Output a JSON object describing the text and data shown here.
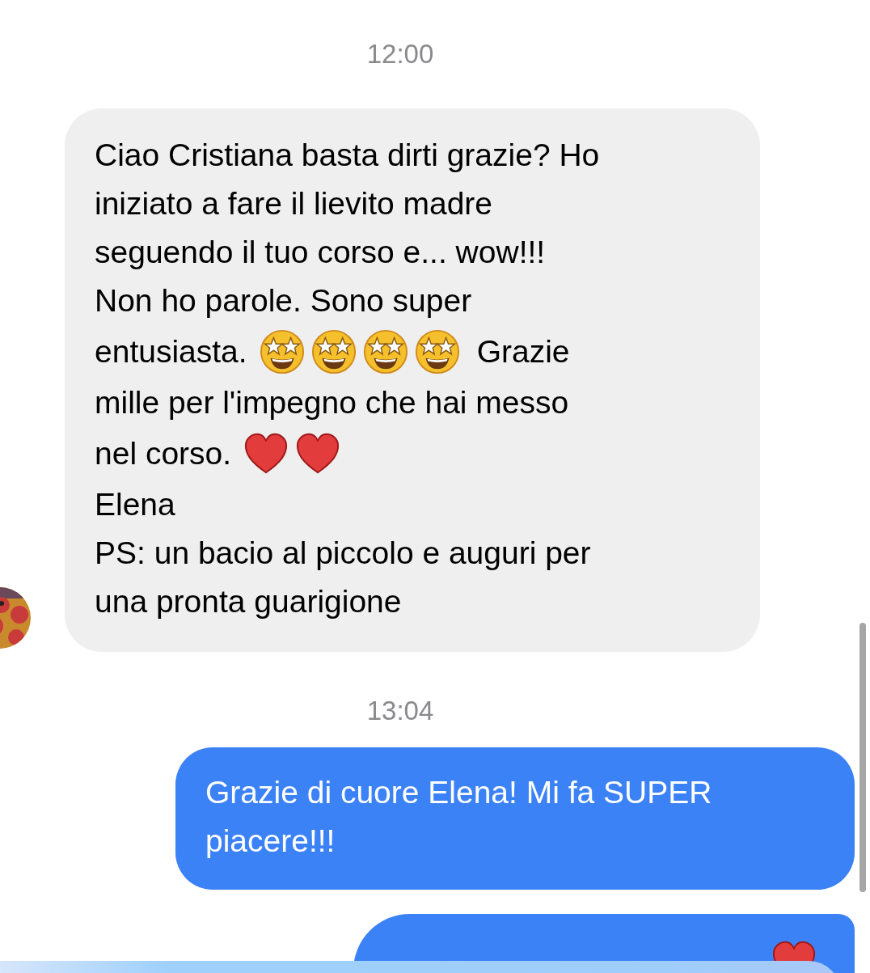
{
  "messages": [
    {
      "kind": "timestamp",
      "text": "12:00"
    },
    {
      "kind": "received",
      "avatar": {
        "kind": "picture"
      },
      "lines": [
        [
          {
            "kind": "text",
            "text": "Ciao Cristiana basta dirti grazie? Ho"
          }
        ],
        [
          {
            "kind": "text",
            "text": "iniziato a fare il lievito madre"
          }
        ],
        [
          {
            "kind": "text",
            "text": "seguendo il tuo corso e... wow!!!"
          }
        ],
        [
          {
            "kind": "text",
            "text": "Non ho parole. Sono super"
          }
        ],
        [
          {
            "kind": "text",
            "text": "entusiasta."
          },
          {
            "kind": "star-struck"
          },
          {
            "kind": "star-struck"
          },
          {
            "kind": "star-struck"
          },
          {
            "kind": "star-struck"
          },
          {
            "kind": "text",
            "text": "Grazie"
          }
        ],
        [
          {
            "kind": "text",
            "text": "mille per l'impegno che hai messo"
          }
        ],
        [
          {
            "kind": "text",
            "text": "nel corso."
          },
          {
            "kind": "heart"
          },
          {
            "kind": "heart"
          }
        ],
        [
          {
            "kind": "text",
            "text": "Elena"
          }
        ],
        [
          {
            "kind": "text",
            "text": "PS: un bacio al piccolo e auguri per"
          }
        ],
        [
          {
            "kind": "text",
            "text": "una pronta guarigione"
          }
        ]
      ]
    },
    {
      "kind": "timestamp",
      "text": "13:04"
    },
    {
      "kind": "sent",
      "lines": [
        [
          {
            "kind": "text",
            "text": "Grazie di cuore Elena! Mi fa SUPER"
          }
        ],
        [
          {
            "kind": "text",
            "text": "piacere!!!"
          }
        ]
      ]
    },
    {
      "kind": "sent",
      "lines": [
        [
          {
            "kind": "heart"
          }
        ]
      ]
    }
  ]
}
